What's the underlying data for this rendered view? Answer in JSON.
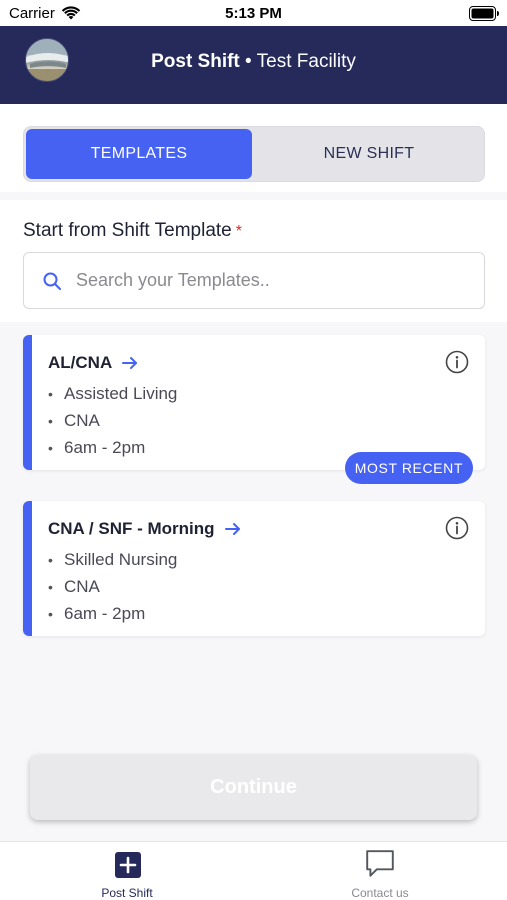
{
  "status_bar": {
    "carrier": "Carrier",
    "time": "5:13 PM"
  },
  "header": {
    "title": "Post Shift",
    "separator": "•",
    "facility": "Test Facility"
  },
  "segments": {
    "templates": "TEMPLATES",
    "new_shift": "NEW SHIFT",
    "active": "templates"
  },
  "template_section": {
    "label": "Start from Shift Template",
    "required_mark": "*",
    "search_placeholder": "Search your Templates.."
  },
  "templates": [
    {
      "title": "AL/CNA",
      "details": [
        "Assisted Living",
        "CNA",
        "6am - 2pm"
      ],
      "badge": "MOST RECENT"
    },
    {
      "title": "CNA / SNF - Morning",
      "details": [
        "Skilled Nursing",
        "CNA",
        "6am - 2pm"
      ]
    }
  ],
  "bullet": "•",
  "continue_label": "Continue",
  "tabs": {
    "post_shift": "Post Shift",
    "contact_us": "Contact us"
  },
  "colors": {
    "header_bg": "#262a5a",
    "accent": "#4662f2",
    "required": "#e02a2a"
  },
  "icons": [
    "wifi-icon",
    "battery-icon",
    "search-icon",
    "arrow-right-icon",
    "info-icon",
    "plus-square-icon",
    "chat-bubble-icon"
  ]
}
